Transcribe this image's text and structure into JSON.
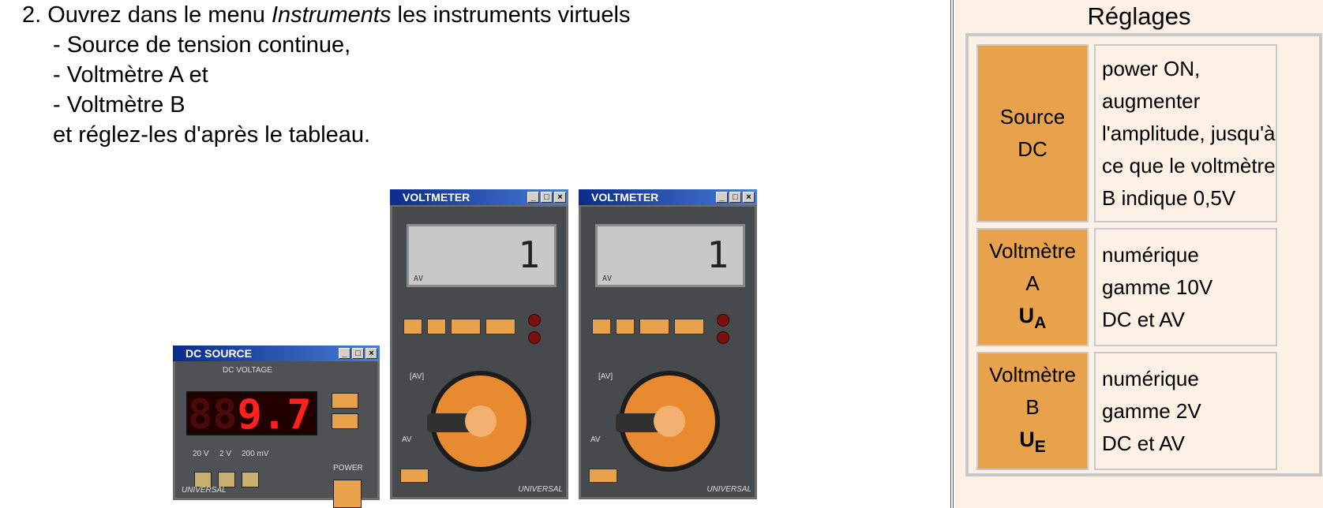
{
  "instructions": {
    "step_number": "2.",
    "step_text_before": "Ouvrez dans le menu ",
    "step_menu": "Instruments",
    "step_text_after": " les instruments virtuels",
    "items": [
      "- Source de tension continue,",
      "- Voltmètre A et",
      "- Voltmètre B"
    ],
    "closing": "et réglez-les d'après le tableau."
  },
  "settings": {
    "title": "Réglages",
    "rows": [
      {
        "key": [
          "Source",
          "DC"
        ],
        "symbol": "",
        "symbol_sub": "",
        "value": [
          "power ON,",
          "augmenter",
          "l'amplitude, jusqu'à",
          "ce que le voltmètre",
          "B indique 0,5V"
        ]
      },
      {
        "key": [
          "Voltmètre",
          "A"
        ],
        "symbol": "U",
        "symbol_sub": "A",
        "value": [
          "numérique",
          "gamme 10V",
          "DC et AV"
        ]
      },
      {
        "key": [
          "Voltmètre",
          "B"
        ],
        "symbol": "U",
        "symbol_sub": "E",
        "value": [
          "numérique",
          "gamme 2V",
          "DC et AV"
        ]
      }
    ]
  },
  "instruments": {
    "dc_source": {
      "title": "DC SOURCE",
      "caption": "DC VOLTAGE",
      "display": "9.7",
      "ghost": "88",
      "ranges": [
        "20 V",
        "2 V",
        "200 mV"
      ],
      "power_label": "POWER",
      "brand": "UNIVERSAL"
    },
    "voltmeter_a": {
      "title": "VOLTMETER",
      "display": "1",
      "brand": "UNIVERSAL",
      "left_label": "[AV]",
      "mid_label": "AV"
    },
    "voltmeter_b": {
      "title": "VOLTMETER",
      "display": "1",
      "brand": "UNIVERSAL",
      "left_label": "[AV]",
      "mid_label": "AV"
    }
  }
}
